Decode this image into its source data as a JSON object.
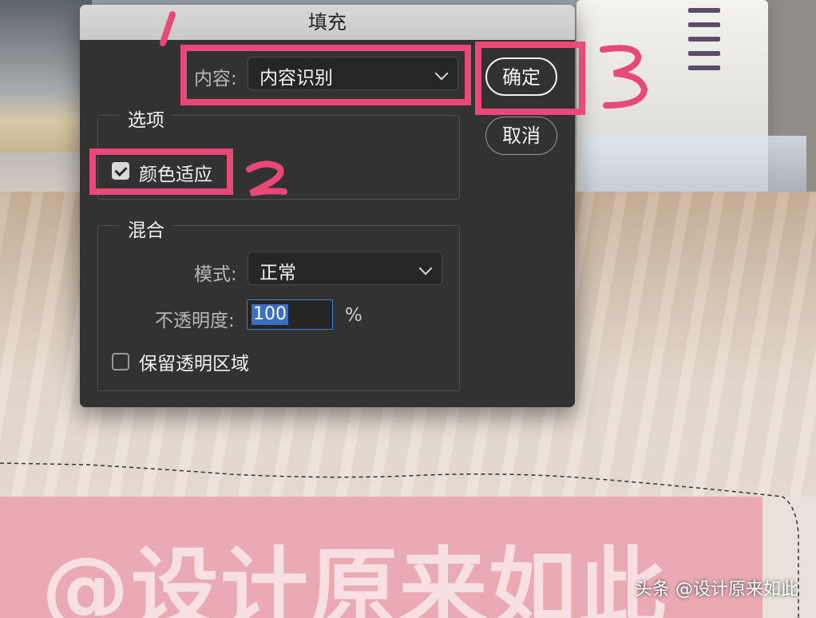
{
  "dialog": {
    "title": "填充",
    "content_label": "内容:",
    "content_value": "内容识别",
    "ok_label": "确定",
    "cancel_label": "取消",
    "options_title": "选项",
    "color_adapt_label": "颜色适应",
    "color_adapt_checked": true,
    "blend_title": "混合",
    "mode_label": "模式:",
    "mode_value": "正常",
    "opacity_label": "不透明度:",
    "opacity_value": "100",
    "opacity_unit": "%",
    "preserve_label": "保留透明区域",
    "preserve_checked": false
  },
  "annotations": {
    "color": "#e8497a",
    "markers": [
      "1",
      "2",
      "3"
    ]
  },
  "background": {
    "overlay_text": "@设计原来如此",
    "watermark": "头条 @设计原来如此"
  }
}
